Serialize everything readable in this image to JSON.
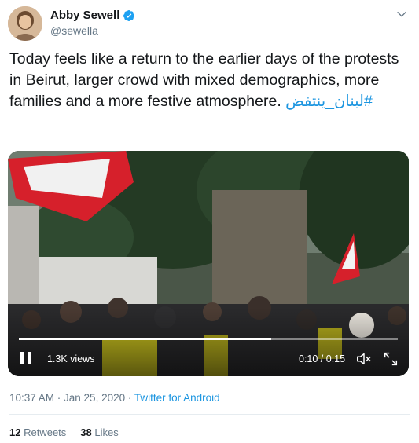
{
  "author": {
    "name": "Abby Sewell",
    "handle": "@sewella"
  },
  "tweet": {
    "text": "Today feels like a return to the earlier days of the protests in Beirut, larger crowd with mixed demographics,  more families and a more festive atmosphere. ",
    "hashtag": "#لبنان_ينتفض"
  },
  "video": {
    "views": "1.3K views",
    "time": "0:10 / 0:15",
    "progress": 0.667
  },
  "meta": {
    "timestamp": "10:37 AM · Jan 25, 2020",
    "separator": " · ",
    "source": "Twitter for Android"
  },
  "stats": {
    "retweets_count": "12",
    "retweets_label": "Retweets",
    "likes_count": "38",
    "likes_label": "Likes"
  },
  "colors": {
    "link": "#1b95e0",
    "secondary_text": "#657786",
    "verified": "#1da1f2"
  },
  "icons": [
    "verified-badge-icon",
    "chevron-down-icon",
    "pause-icon",
    "mute-icon",
    "fullscreen-icon"
  ]
}
